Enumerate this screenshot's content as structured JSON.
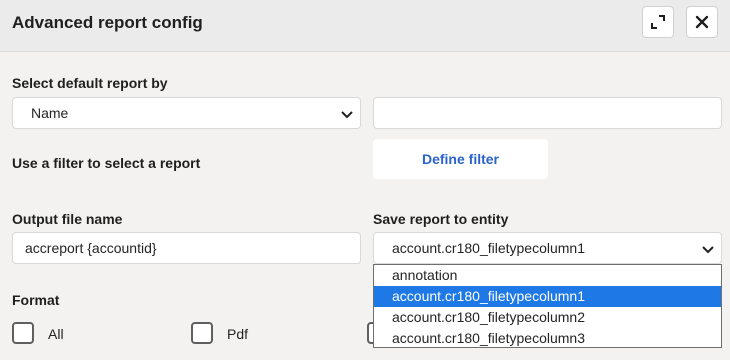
{
  "dialog": {
    "title": "Advanced report config",
    "maximize_icon": "maximize-icon",
    "close_icon": "close-icon"
  },
  "report_select": {
    "label": "Select default report by",
    "selected": "Name",
    "text_value": ""
  },
  "filter": {
    "label": "Use a filter to select a report",
    "button_label": "Define filter"
  },
  "output": {
    "label": "Output file name",
    "value": "accreport {accountid}"
  },
  "entity": {
    "label": "Save report to entity",
    "selected": "account.cr180_filetypecolumn1",
    "options": [
      "annotation",
      "account.cr180_filetypecolumn1",
      "account.cr180_filetypecolumn2",
      "account.cr180_filetypecolumn3"
    ],
    "highlighted_index": 1
  },
  "format": {
    "label": "Format",
    "options": [
      {
        "label": "All",
        "checked": false
      },
      {
        "label": "Pdf",
        "checked": false
      },
      {
        "label": "",
        "checked": false
      }
    ]
  },
  "colors": {
    "accent": "#2a63cc",
    "highlight": "#1e79e6"
  }
}
